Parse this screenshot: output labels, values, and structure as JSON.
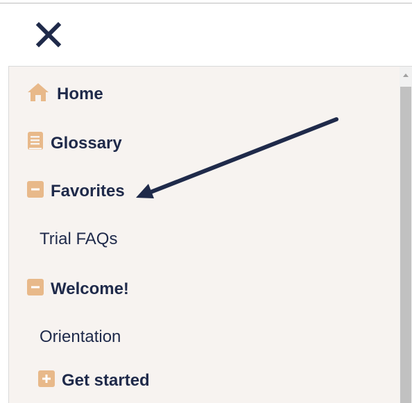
{
  "header": {
    "close_icon": "close-icon"
  },
  "nav": {
    "home": {
      "label": "Home",
      "icon": "home-icon"
    },
    "glossary": {
      "label": "Glossary",
      "icon": "book-icon"
    },
    "favorites": {
      "label": "Favorites",
      "icon": "minus-box-icon",
      "expanded": true,
      "children": [
        {
          "label": "Trial FAQs"
        }
      ]
    },
    "welcome": {
      "label": "Welcome!",
      "icon": "minus-box-icon",
      "expanded": true,
      "children": [
        {
          "label": "Orientation"
        }
      ]
    },
    "get_started": {
      "label": "Get started",
      "icon": "plus-box-icon",
      "expanded": false
    }
  },
  "colors": {
    "accent": "#e8b98a",
    "text": "#1f2a4a",
    "panel_bg": "#f7f3f0",
    "arrow": "#1f2a4a"
  }
}
